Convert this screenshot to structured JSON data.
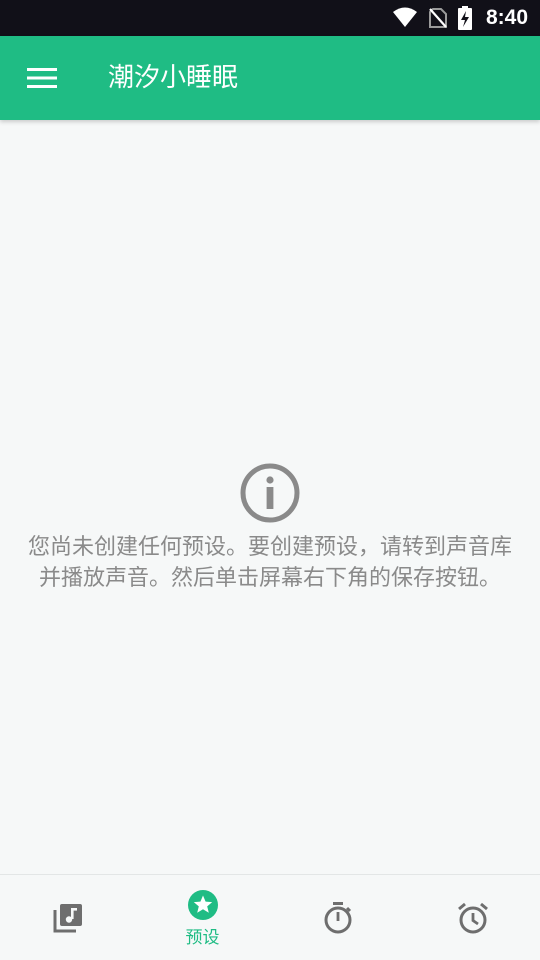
{
  "status_bar": {
    "time": "8:40",
    "icons": [
      "wifi-icon",
      "no-sim-icon",
      "battery-charging-icon"
    ]
  },
  "app_bar": {
    "title": "潮汐小睡眠",
    "menu_icon": "hamburger-menu-icon"
  },
  "empty_state": {
    "icon": "info-icon",
    "message": "您尚未创建任何预设。要创建预设，请转到声音库并播放声音。然后单击屏幕右下角的保存按钮。"
  },
  "bottom_nav": {
    "items": [
      {
        "id": "library",
        "icon": "music-library-icon",
        "label": "",
        "active": false
      },
      {
        "id": "presets",
        "icon": "star-circle-icon",
        "label": "预设",
        "active": true
      },
      {
        "id": "timer",
        "icon": "stopwatch-icon",
        "label": "",
        "active": false
      },
      {
        "id": "alarm",
        "icon": "alarm-clock-icon",
        "label": "",
        "active": false
      }
    ]
  },
  "colors": {
    "primary": "#1fbc84",
    "status_bar": "#111018",
    "background": "#f6f8f8",
    "text_muted": "#8a8a8a",
    "icon_inactive": "#6e6e6e"
  }
}
